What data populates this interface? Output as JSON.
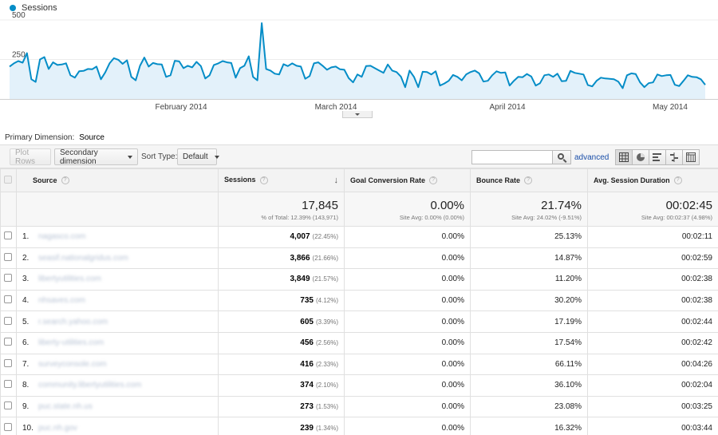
{
  "chart_data": {
    "type": "area",
    "legend": "Sessions",
    "color": "#058dc7",
    "fill": "#e3f1fa",
    "ylim": [
      0,
      500
    ],
    "y_ticks": [
      500,
      250
    ],
    "x_labels": [
      "February 2014",
      "March 2014",
      "April 2014",
      "May 2014"
    ],
    "values": [
      205,
      225,
      240,
      230,
      290,
      125,
      108,
      250,
      265,
      190,
      232,
      215,
      218,
      226,
      150,
      135,
      175,
      178,
      190,
      188,
      205,
      125,
      168,
      225,
      258,
      248,
      222,
      245,
      140,
      118,
      210,
      262,
      205,
      228,
      220,
      218,
      140,
      150,
      242,
      238,
      195,
      210,
      200,
      235,
      208,
      130,
      150,
      215,
      225,
      240,
      232,
      228,
      135,
      195,
      210,
      270,
      140,
      118,
      480,
      190,
      180,
      160,
      155,
      220,
      208,
      225,
      210,
      205,
      128,
      145,
      225,
      232,
      210,
      185,
      200,
      205,
      188,
      185,
      132,
      105,
      155,
      140,
      208,
      210,
      195,
      180,
      165,
      218,
      180,
      170,
      142,
      75,
      180,
      140,
      75,
      172,
      170,
      155,
      175,
      85,
      98,
      115,
      152,
      140,
      118,
      155,
      170,
      180,
      162,
      110,
      115,
      150,
      175,
      165,
      168,
      85,
      115,
      140,
      138,
      158,
      142,
      85,
      100,
      150,
      155,
      140,
      160,
      112,
      115,
      178,
      165,
      160,
      155,
      88,
      80,
      115,
      135,
      130,
      128,
      125,
      110,
      68,
      150,
      162,
      158,
      105,
      75,
      100,
      105,
      155,
      145,
      150,
      152,
      90,
      82,
      115,
      150,
      140,
      138,
      125,
      90
    ]
  },
  "header": {
    "primary_dimension_label": "Primary Dimension:",
    "primary_dimension_value": "Source"
  },
  "toolbar": {
    "plot_rows": "Plot Rows",
    "secondary_dimension": "Secondary dimension",
    "sort_type_label": "Sort Type:",
    "sort_type_value": "Default",
    "search_value": "",
    "advanced": "advanced"
  },
  "table": {
    "columns": [
      "Source",
      "Sessions",
      "Goal Conversion Rate",
      "Bounce Rate",
      "Avg. Session Duration"
    ],
    "summary": {
      "sessions": "17,845",
      "sessions_sub": "% of Total: 12.39% (143,971)",
      "goal_conv": "0.00%",
      "goal_conv_sub": "Site Avg: 0.00% (0.00%)",
      "bounce": "21.74%",
      "bounce_sub": "Site Avg: 24.02% (-9.51%)",
      "duration": "00:02:45",
      "duration_sub": "Site Avg: 00:02:37 (4.98%)"
    },
    "rows": [
      {
        "idx": "1.",
        "source": "nagasco.com",
        "sessions": "4,007",
        "pct": "(22.45%)",
        "goal": "0.00%",
        "bounce": "25.13%",
        "duration": "00:02:11"
      },
      {
        "idx": "2.",
        "source": "seasif.nationalgridus.com",
        "sessions": "3,866",
        "pct": "(21.66%)",
        "goal": "0.00%",
        "bounce": "14.87%",
        "duration": "00:02:59"
      },
      {
        "idx": "3.",
        "source": "libertyutilities.com",
        "sessions": "3,849",
        "pct": "(21.57%)",
        "goal": "0.00%",
        "bounce": "11.20%",
        "duration": "00:02:38"
      },
      {
        "idx": "4.",
        "source": "nhsaves.com",
        "sessions": "735",
        "pct": "(4.12%)",
        "goal": "0.00%",
        "bounce": "30.20%",
        "duration": "00:02:38"
      },
      {
        "idx": "5.",
        "source": "r.search.yahoo.com",
        "sessions": "605",
        "pct": "(3.39%)",
        "goal": "0.00%",
        "bounce": "17.19%",
        "duration": "00:02:44"
      },
      {
        "idx": "6.",
        "source": "liberty-utilities.com",
        "sessions": "456",
        "pct": "(2.56%)",
        "goal": "0.00%",
        "bounce": "17.54%",
        "duration": "00:02:42"
      },
      {
        "idx": "7.",
        "source": "surveyconsole.com",
        "sessions": "416",
        "pct": "(2.33%)",
        "goal": "0.00%",
        "bounce": "66.11%",
        "duration": "00:04:26"
      },
      {
        "idx": "8.",
        "source": "community.libertyutilities.com",
        "sessions": "374",
        "pct": "(2.10%)",
        "goal": "0.00%",
        "bounce": "36.10%",
        "duration": "00:02:04"
      },
      {
        "idx": "9.",
        "source": "puc.state.nh.us",
        "sessions": "273",
        "pct": "(1.53%)",
        "goal": "0.00%",
        "bounce": "23.08%",
        "duration": "00:03:25"
      },
      {
        "idx": "10.",
        "source": "puc.nh.gov",
        "sessions": "239",
        "pct": "(1.34%)",
        "goal": "0.00%",
        "bounce": "16.32%",
        "duration": "00:03:44"
      }
    ]
  }
}
